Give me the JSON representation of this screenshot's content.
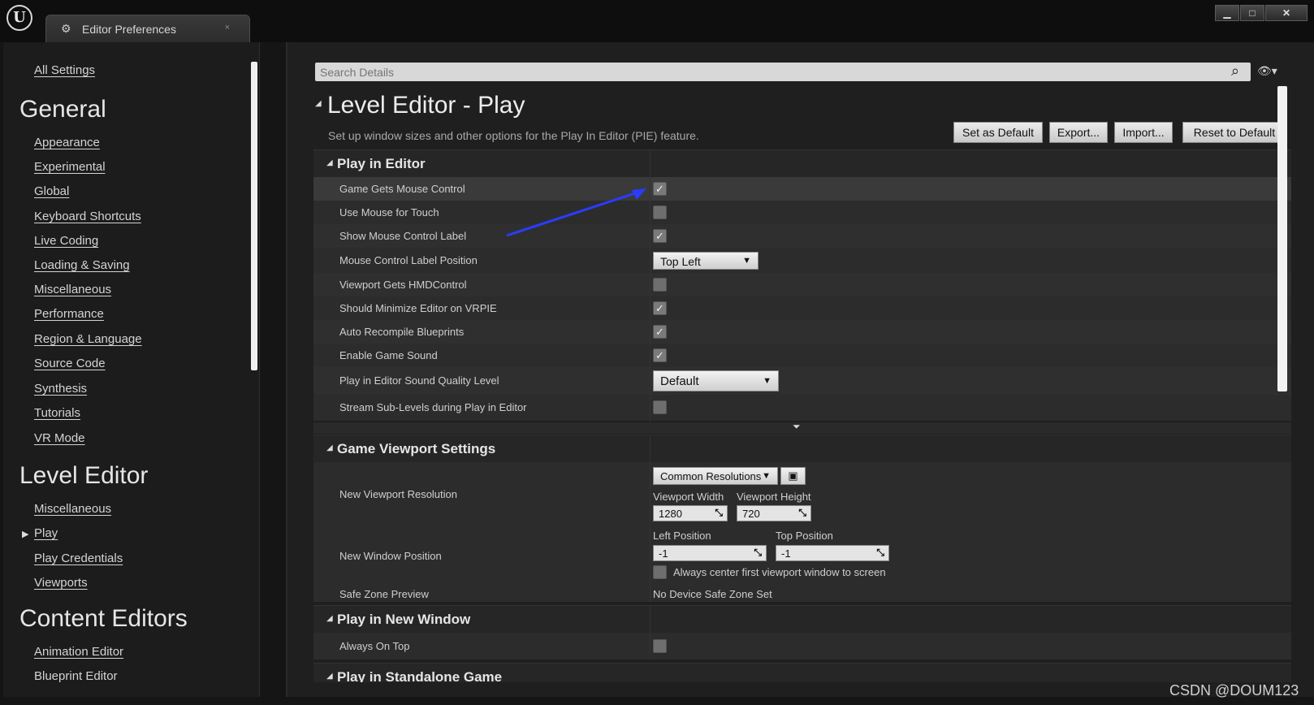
{
  "window": {
    "logo": "U",
    "tab_label": "Editor Preferences",
    "tab_close": "×",
    "minimize": "▁",
    "maximize": "□",
    "close": "✕"
  },
  "nav": {
    "all_settings": "All Settings",
    "general": {
      "heading": "General",
      "items": [
        "Appearance",
        "Experimental",
        "Global",
        "Keyboard Shortcuts",
        "Live Coding",
        "Loading & Saving",
        "Miscellaneous",
        "Performance",
        "Region & Language",
        "Source Code",
        "Synthesis",
        "Tutorials",
        "VR Mode"
      ]
    },
    "level_editor": {
      "heading": "Level Editor",
      "items": [
        "Miscellaneous",
        "Play",
        "Play Credentials",
        "Viewports"
      ]
    },
    "content_editors": {
      "heading": "Content Editors",
      "items": [
        "Animation Editor",
        "Blueprint Editor"
      ]
    }
  },
  "search": {
    "placeholder": "Search Details"
  },
  "page": {
    "title": "Level Editor - Play",
    "description": "Set up window sizes and other options for the Play In Editor (PIE) feature.",
    "buttons": {
      "set_default": "Set as Default",
      "export": "Export...",
      "import": "Import...",
      "reset": "Reset to Default"
    }
  },
  "categories": {
    "play_in_editor": {
      "title": "Play in Editor",
      "props": [
        {
          "label": "Game Gets Mouse Control",
          "checked": true
        },
        {
          "label": "Use Mouse for Touch",
          "checked": false
        },
        {
          "label": "Show Mouse Control Label",
          "checked": true
        },
        {
          "label": "Mouse Control Label Position",
          "dropdown": "Top Left"
        },
        {
          "label": "Viewport Gets HMDControl",
          "checked": false
        },
        {
          "label": "Should Minimize Editor on VRPIE",
          "checked": true
        },
        {
          "label": "Auto Recompile Blueprints",
          "checked": true
        },
        {
          "label": "Enable Game Sound",
          "checked": true
        },
        {
          "label": "Play in Editor Sound Quality Level",
          "dropdown": "Default"
        },
        {
          "label": "Stream Sub-Levels during Play in Editor",
          "checked": false
        }
      ]
    },
    "game_viewport": {
      "title": "Game Viewport Settings",
      "new_viewport_resolution": "New Viewport Resolution",
      "common_resolutions": "Common Resolutions",
      "viewport_width_label": "Viewport Width",
      "viewport_width": "1280",
      "viewport_height_label": "Viewport Height",
      "viewport_height": "720",
      "new_window_position": "New Window Position",
      "left_position_label": "Left Position",
      "left_position": "-1",
      "top_position_label": "Top Position",
      "top_position": "-1",
      "center_label": "Always center first viewport window to screen",
      "safe_zone_label": "Safe Zone Preview",
      "safe_zone_value": "No Device Safe Zone Set"
    },
    "play_in_new_window": {
      "title": "Play in New Window",
      "always_on_top": "Always On Top"
    },
    "play_standalone": {
      "title": "Play in Standalone Game"
    }
  },
  "watermark": "CSDN @DOUM123",
  "colors": {
    "arrow": "#2a3cff"
  }
}
